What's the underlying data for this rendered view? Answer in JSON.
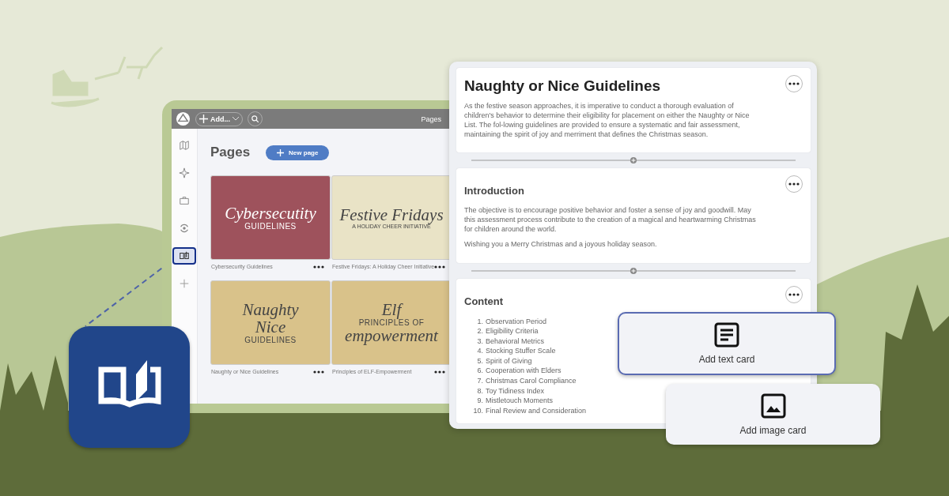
{
  "app_window": {
    "toolbar": {
      "add_button": "Add...",
      "location": "Pages"
    },
    "sidebar": {
      "items": [
        {
          "selected": false
        },
        {
          "selected": false
        },
        {
          "selected": false
        },
        {
          "selected": false
        },
        {
          "selected": true
        },
        {
          "selected": false
        }
      ]
    },
    "heading": "Pages",
    "new_page_button": "New page",
    "pages": [
      {
        "name": "Cybersecurity Guidelines",
        "color": "#9e525c",
        "cover": [
          {
            "text": "Cybersecutity",
            "kind": "script"
          },
          {
            "text": "GUIDELINES",
            "kind": "caps"
          }
        ]
      },
      {
        "name": "Festive Fridays: A Holiday Cheer Initiative",
        "color": "#e9e3c6",
        "cover": [
          {
            "text": "Festive Fridays",
            "kind": "script"
          },
          {
            "text": "A HOLIDAY CHEER INITIATIVE",
            "kind": "small"
          }
        ]
      },
      {
        "name": "Naughty or Nice Guidelines",
        "color": "#d9c28a",
        "cover": [
          {
            "text": "Naughty",
            "kind": "script"
          },
          {
            "text": "Nice",
            "kind": "script"
          },
          {
            "text": "GUIDELINES",
            "kind": "caps"
          }
        ]
      },
      {
        "name": "Principles of ELF-Empowerment",
        "color": "#d9c28a",
        "cover": [
          {
            "text": "Elf",
            "kind": "script"
          },
          {
            "text": "PRINCIPLES OF",
            "kind": "caps"
          },
          {
            "text": "empowerment",
            "kind": "script"
          }
        ]
      }
    ]
  },
  "editor": {
    "cards": [
      {
        "kind": "title",
        "title": "Naughty or Nice Guidelines",
        "paragraphs": [
          "As the festive season approaches, it is imperative to conduct a thorough evaluation of children's behavior to determine their eligibility for placement on either the Naughty or Nice List. The fol-lowing guidelines are provided to ensure a systematic and fair assessment, maintaining the spirit of joy and merriment that defines the Christmas season."
        ]
      },
      {
        "kind": "section",
        "title": "Introduction",
        "paragraphs": [
          "The objective is to encourage positive behavior and foster a sense of joy and goodwill. May this assessment process contribute to the creation of a magical and heartwarming Christmas for children around the world.",
          "Wishing you a Merry Christmas and a joyous holiday season."
        ]
      },
      {
        "kind": "section",
        "title": "Content",
        "list": [
          {
            "number": "1.",
            "text": "Observation Period"
          },
          {
            "number": "2.",
            "text": "Eligibility Criteria"
          },
          {
            "number": "3.",
            "text": "Behavioral Metrics"
          },
          {
            "number": "4.",
            "text": "Stocking Stuffer Scale"
          },
          {
            "number": "5.",
            "text": "Spirit of Giving"
          },
          {
            "number": "6.",
            "text": "Cooperation with Elders"
          },
          {
            "number": "7.",
            "text": "Christmas Carol Compliance"
          },
          {
            "number": "8.",
            "text": "Toy Tidiness Index"
          },
          {
            "number": "9.",
            "text": "Mistletouch Moments"
          },
          {
            "number": "10.",
            "text": "Final Review and Consideration"
          }
        ]
      }
    ]
  },
  "add_cards": [
    {
      "kind": "text",
      "label": "Add text card",
      "selected": true
    },
    {
      "kind": "image",
      "label": "Add image card",
      "selected": false
    }
  ]
}
